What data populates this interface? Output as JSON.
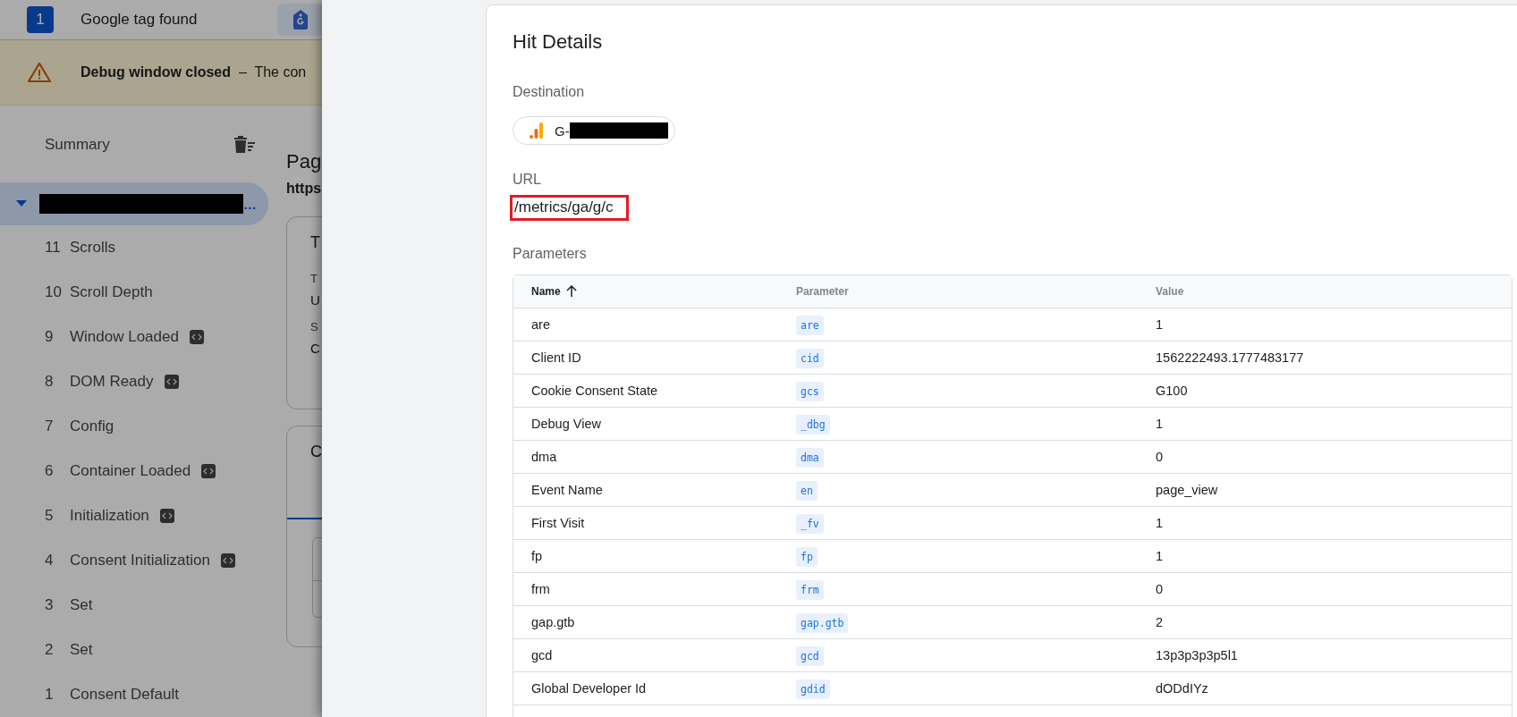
{
  "header": {
    "tag_count": "1",
    "title": "Google tag found"
  },
  "banner": {
    "text": "**Debug window closed**  –  The con"
  },
  "sidebar": {
    "summary": "Summary",
    "page": {
      "label": "…",
      "expanded": true,
      "selected": true
    },
    "events": [
      {
        "number": "11",
        "label": "Scrolls",
        "code_badge": false,
        "selected": false
      },
      {
        "number": "10",
        "label": "Scroll Depth",
        "code_badge": false,
        "selected": false
      },
      {
        "number": "9",
        "label": "Window Loaded",
        "code_badge": true,
        "selected": false
      },
      {
        "number": "8",
        "label": "DOM Ready",
        "code_badge": true,
        "selected": false
      },
      {
        "number": "7",
        "label": "Config",
        "code_badge": false,
        "selected": false
      },
      {
        "number": "6",
        "label": "Container Loaded",
        "code_badge": true,
        "selected": false
      },
      {
        "number": "5",
        "label": "Initialization",
        "code_badge": true,
        "selected": false
      },
      {
        "number": "4",
        "label": "Consent Initialization",
        "code_badge": true,
        "selected": false
      },
      {
        "number": "3",
        "label": "Set",
        "code_badge": false,
        "selected": false
      },
      {
        "number": "2",
        "label": "Set",
        "code_badge": false,
        "selected": false
      },
      {
        "number": "1",
        "label": "Consent Default",
        "code_badge": false,
        "selected": false
      }
    ]
  },
  "main": {
    "title": "Pag",
    "url": "https",
    "cards": [
      {
        "title": "T",
        "fields": [
          {
            "label": "T",
            "value": "U"
          },
          {
            "label": "S",
            "value": "C"
          }
        ]
      },
      {
        "title": "C"
      }
    ]
  },
  "drawer": {
    "title": "Hit Details",
    "destination_label": "Destination",
    "destination": "G-",
    "url_label": "URL",
    "url": "/metrics/ga/g/c",
    "url_highlighted": true,
    "parameters_label": "Parameters",
    "table": {
      "columns": [
        {
          "label": "Name",
          "sorted": true
        },
        {
          "label": "Parameter",
          "sorted": false
        },
        {
          "label": "Value",
          "sorted": false
        }
      ],
      "rows": [
        {
          "name": "are",
          "parameter": "are",
          "value": "1"
        },
        {
          "name": "Client ID",
          "parameter": "cid",
          "value": "1562222493.1777483177"
        },
        {
          "name": "Cookie Consent State",
          "parameter": "gcs",
          "value": "G100"
        },
        {
          "name": "Debug View",
          "parameter": "_dbg",
          "value": "1"
        },
        {
          "name": "dma",
          "parameter": "dma",
          "value": "0"
        },
        {
          "name": "Event Name",
          "parameter": "en",
          "value": "page_view"
        },
        {
          "name": "First Visit",
          "parameter": "_fv",
          "value": "1"
        },
        {
          "name": "fp",
          "parameter": "fp",
          "value": "1"
        },
        {
          "name": "frm",
          "parameter": "frm",
          "value": "0"
        },
        {
          "name": "gap.gtb",
          "parameter": "gap.gtb",
          "value": "2"
        },
        {
          "name": "gcd",
          "parameter": "gcd",
          "value": "13p3p3p3p5l1"
        },
        {
          "name": "Global Developer Id",
          "parameter": "gdid",
          "value": "dODdIYz"
        }
      ]
    }
  }
}
